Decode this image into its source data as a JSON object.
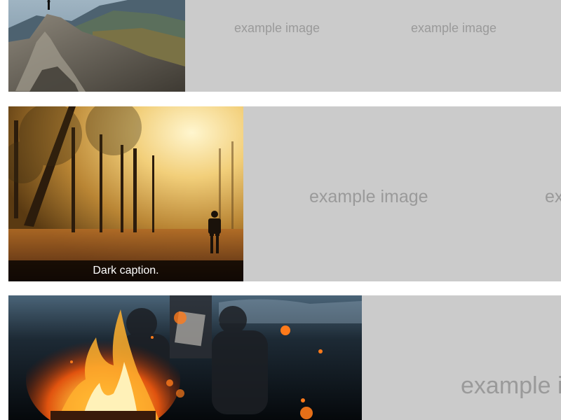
{
  "gallery": {
    "rows": [
      {
        "photo_subject": "mountain-summit",
        "placeholders": [
          "example image",
          "example image"
        ]
      },
      {
        "photo_subject": "misty-forest-walker",
        "caption": "Dark caption.",
        "placeholders": [
          "example image",
          "example image"
        ]
      },
      {
        "photo_subject": "campfire-night",
        "placeholders": [
          "example image"
        ]
      }
    ]
  },
  "colors": {
    "placeholder_background": "#cbcbcb",
    "placeholder_text": "#9a9a9a",
    "caption_background": "#000000",
    "caption_text": "#ffffff"
  }
}
